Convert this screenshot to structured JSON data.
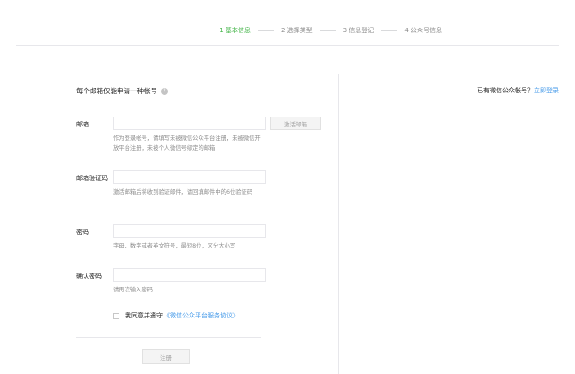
{
  "steps": [
    {
      "label": "1 基本信息",
      "active": true
    },
    {
      "label": "2 选择类型",
      "active": false
    },
    {
      "label": "3 信息登记",
      "active": false
    },
    {
      "label": "4 公众号信息",
      "active": false
    }
  ],
  "form": {
    "tip": "每个邮箱仅能申请一种帐号",
    "help_icon": "?",
    "email": {
      "label": "邮箱",
      "value": "",
      "hint": "作为登录帐号，请填写未被微信公众平台注册，未被微信开放平台注册，未被个人微信号绑定的邮箱",
      "activate_label": "激活邮箱"
    },
    "code": {
      "label": "邮箱验证码",
      "value": "",
      "hint": "激活邮箱后将收到验证邮件，请回填邮件中的6位验证码"
    },
    "password": {
      "label": "密码",
      "value": "",
      "hint": "字母、数字或者英文符号，最短8位，区分大小写"
    },
    "confirm": {
      "label": "确认密码",
      "value": "",
      "hint": "请再次输入密码"
    },
    "agree_text": "我同意并遵守",
    "agreement_link": "《微信公众平台服务协议》",
    "register_label": "注册"
  },
  "login": {
    "prompt": "已有微信公众帐号？",
    "link": "立即登录"
  },
  "colors": {
    "accent": "#44b549",
    "link": "#459ae9",
    "muted": "#8d8d8d",
    "border": "#e7e7eb"
  }
}
